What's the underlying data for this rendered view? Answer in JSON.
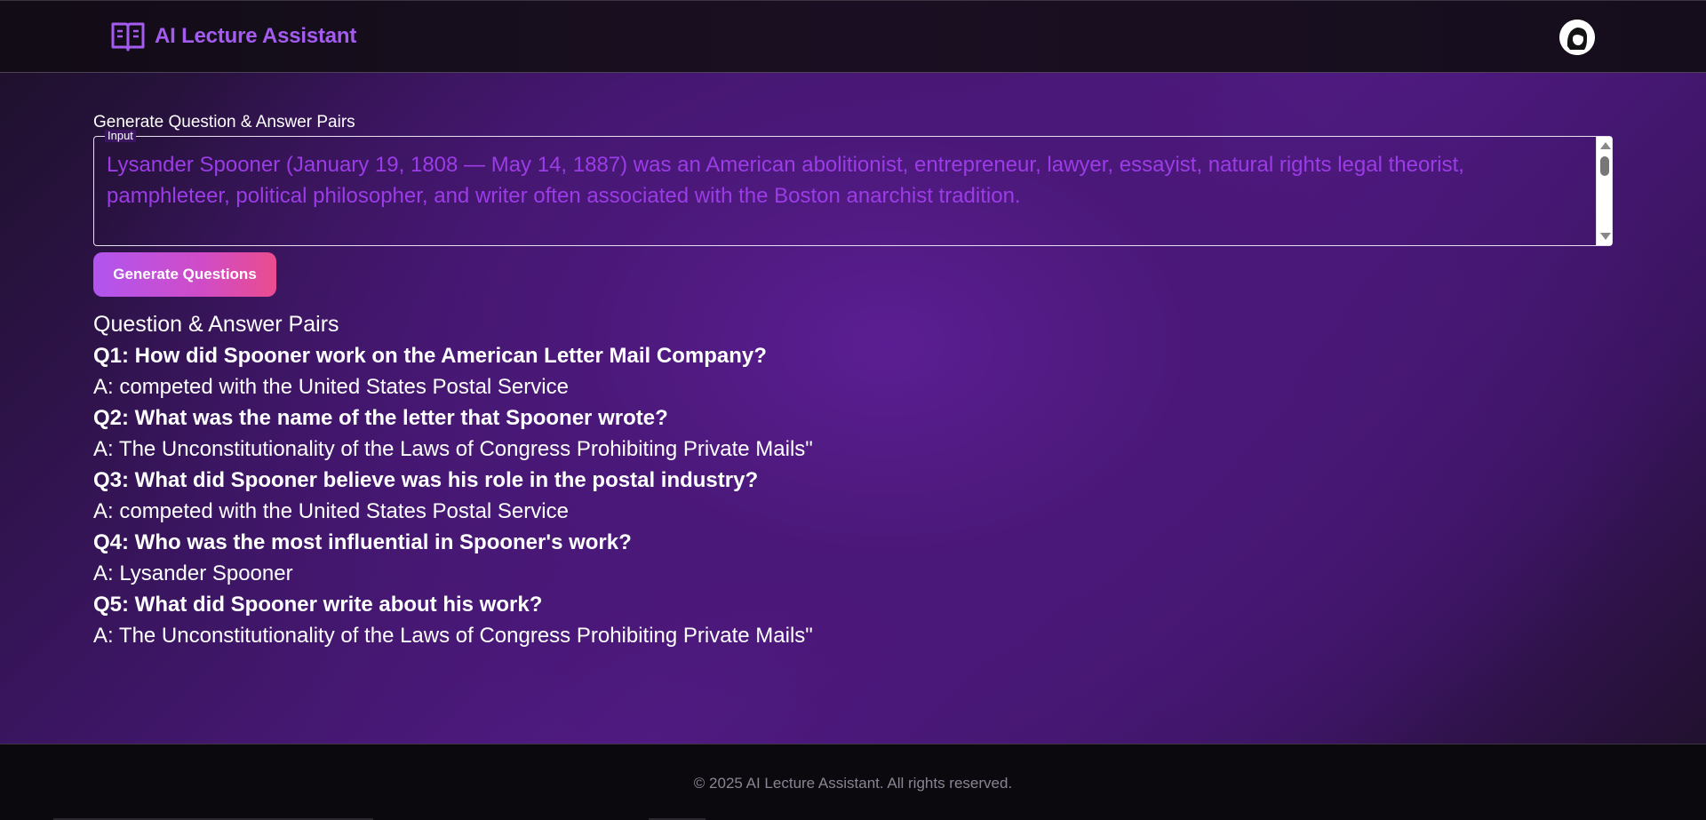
{
  "header": {
    "brand_icon": "open-book-icon",
    "title": "AI Lecture Assistant",
    "avatar_icon": "user-avatar-icon"
  },
  "generator": {
    "section_label": "Generate Question & Answer Pairs",
    "input_label": "Input",
    "input_value": "Lysander Spooner (January 19, 1808 — May 14, 1887) was an American abolitionist, entrepreneur, lawyer, essayist, natural rights legal theorist, pamphleteer, political philosopher, and writer often associated with the Boston anarchist tradition.",
    "button_label": "Generate Questions"
  },
  "results": {
    "heading": "Question & Answer Pairs",
    "pairs": [
      {
        "q": "Q1: How did Spooner work on the American Letter Mail Company?",
        "a": "A: competed with the United States Postal Service"
      },
      {
        "q": "Q2: What was the name of the letter that Spooner wrote?",
        "a": "A: The Unconstitutionality of the Laws of Congress Prohibiting Private Mails\""
      },
      {
        "q": "Q3: What did Spooner believe was his role in the postal industry?",
        "a": "A: competed with the United States Postal Service"
      },
      {
        "q": "Q4: Who was the most influential in Spooner's work?",
        "a": "A: Lysander Spooner"
      },
      {
        "q": "Q5: What did Spooner write about his work?",
        "a": "A: The Unconstitutionality of the Laws of Congress Prohibiting Private Mails\""
      }
    ]
  },
  "footer": {
    "copyright": "© 2025 AI Lecture Assistant. All rights reserved."
  },
  "colors": {
    "brand": "#a45cf0",
    "input_text": "#9b3ce6",
    "button_start": "#b155ef",
    "button_end": "#ea4c8e"
  }
}
